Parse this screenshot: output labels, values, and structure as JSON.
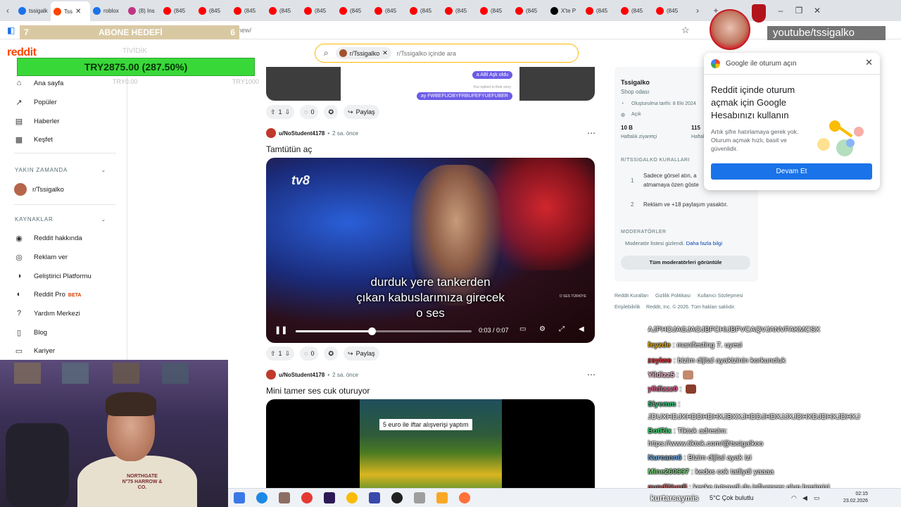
{
  "browser": {
    "tabs": [
      {
        "label": "tssigalko",
        "color": "#1a73e8"
      },
      {
        "label": "Tss",
        "color": "#ff4500",
        "active": true
      },
      {
        "label": "roblox",
        "color": "#1a73e8"
      },
      {
        "label": "(8) Ins",
        "color": "#c13584"
      },
      {
        "label": "(845",
        "color": "#ff0000"
      },
      {
        "label": "(845",
        "color": "#ff0000"
      },
      {
        "label": "(845",
        "color": "#ff0000"
      },
      {
        "label": "(845",
        "color": "#ff0000"
      },
      {
        "label": "(845",
        "color": "#ff0000"
      },
      {
        "label": "(845",
        "color": "#ff0000"
      },
      {
        "label": "(845",
        "color": "#ff0000"
      },
      {
        "label": "(845",
        "color": "#ff0000"
      },
      {
        "label": "(845",
        "color": "#ff0000"
      },
      {
        "label": "(845",
        "color": "#ff0000"
      },
      {
        "label": "(845",
        "color": "#ff0000"
      },
      {
        "label": "X'te P",
        "color": "#000000"
      },
      {
        "label": "(845",
        "color": "#ff0000"
      },
      {
        "label": "(845",
        "color": "#ff0000"
      },
      {
        "label": "(845",
        "color": "#ff0000"
      }
    ],
    "url_fragment": "new/"
  },
  "overlay": {
    "goal_left": "7",
    "goal_label": "ABONE HEDEFİ",
    "goal_right": "6",
    "donation": "TRY2875.00 (287.50%)",
    "scale_left": "TRY0.00",
    "scale_right": "TRY1000",
    "watermark": "TİVİDİK",
    "yt_handle": "youtube/tssigalko"
  },
  "reddit": {
    "logo": "reddit",
    "search_chip": "r/Tssigalko",
    "search_placeholder": "r/Tssigalko içinde ara"
  },
  "sidebar": {
    "items": [
      {
        "label": "Ana sayfa",
        "icon": "home-icon",
        "glyph": "⌂"
      },
      {
        "label": "Popüler",
        "icon": "popular-icon",
        "glyph": "↗"
      },
      {
        "label": "Haberler",
        "icon": "news-icon",
        "glyph": "▤"
      },
      {
        "label": "Keşfet",
        "icon": "explore-icon",
        "glyph": "▦"
      }
    ],
    "recent_heading": "YAKIN ZAMANDA",
    "recent_item": "r/Tssigalko",
    "resources_heading": "KAYNAKLAR",
    "resources": [
      {
        "label": "Reddit hakkında",
        "icon": "reddit-about-icon",
        "glyph": "◉"
      },
      {
        "label": "Reklam ver",
        "icon": "advertise-icon",
        "glyph": "◎"
      },
      {
        "label": "Geliştirici Platformu",
        "icon": "developer-icon",
        "glyph": "◑"
      },
      {
        "label": "Reddit Pro",
        "icon": "reddit-pro-icon",
        "glyph": "◐",
        "badge": "BETA"
      },
      {
        "label": "Yardım Merkezi",
        "icon": "help-icon",
        "glyph": "?"
      },
      {
        "label": "Blog",
        "icon": "blog-icon",
        "glyph": "▯"
      },
      {
        "label": "Kariyer",
        "icon": "careers-icon",
        "glyph": "▭"
      }
    ]
  },
  "feed": {
    "top_post": {
      "bubble1": "a ABİ Aşk oldu",
      "note": "You replied to their story",
      "bubble2": "ay FWBEFUOBYFRBUFEFYUEFUBER",
      "votes": "1",
      "comments": "0",
      "share": "Paylaş"
    },
    "post1": {
      "user": "u/NoStudent4178",
      "time": "2 sa. önce",
      "title": "Tamtütün aç",
      "channel_logo": "tv8",
      "subtitle_line1": "durduk yere  tankerden",
      "subtitle_line2": "çıkan kabuslarımıza girecek",
      "subtitle_line3": "o ses",
      "watermark": "O SES TÜRKİYE",
      "time_display": "0:03 / 0:07",
      "progress": 0.43,
      "votes": "1",
      "comments": "0",
      "share": "Paylaş"
    },
    "post2": {
      "user": "u/NoStudent4178",
      "time": "2 sa. önce",
      "title": "Mini tamer ses cuk oturuyor",
      "caption": "5 euro ile iftar alışverişi yaptım"
    }
  },
  "rsb": {
    "name": "Tssigalko",
    "desc": "Shop odası",
    "created": "Oluşturulma tarihi: 8 Eki 2024",
    "visibility": "Açık",
    "visitors_value": "10 B",
    "visitors_label": "Haftalık ziyaretçi",
    "contrib_value": "115",
    "contrib_label": "Haftalık",
    "rules_heading": "R/TSSIGALKO KURALLARI",
    "rule1_num": "1",
    "rule1": "Sadece görsel atın, a",
    "rule1b": "atmamaya özen göste",
    "rule2_num": "2",
    "rule2": "Reklam ve +18 paylaşım yasaktır.",
    "mod_heading": "MODERATÖRLER",
    "mod_hidden": "Moderatör listesi gizlendi.",
    "mod_more": "Daha fazla bilgi",
    "mod_button": "Tüm moderatörleri görüntüle",
    "footer_links": [
      "Reddit Kuralları",
      "Gizlilik Politikası",
      "Kullanıcı Sözleşmesi"
    ],
    "footer2": "Erişilebilirlik",
    "copyright": "Reddit, Inc. © 2026. Tüm hakları saklıdır."
  },
  "google_popup": {
    "header": "Google ile oturum açın",
    "title": "Reddit içinde oturum açmak için Google Hesabınızı kullanın",
    "desc": "Artık şifre hatırlamaya gerek yok. Oturum açmak hızlı, basit ve güvenlidir.",
    "button": "Devam Et"
  },
  "webcam": {
    "shirt_text": "NORTHGATE N°75 HARROW & CO."
  },
  "chat": [
    {
      "name": "",
      "text": "AJPHOJAGJAOJBFCHIJBFVCAQVJANVFAKMCSX",
      "color": "#ffffff"
    },
    {
      "name": "feyzde",
      "text": ": manifesting 7. uyesi",
      "color": "#e0a800"
    },
    {
      "name": "zsyiwe",
      "text": ": bizim dijital ayakizinin korkuncluk",
      "color": "#d2343b"
    },
    {
      "name": "Yildizz5",
      "text": ":",
      "color": "#f5b7d0",
      "emote": "#c28a6e"
    },
    {
      "name": "yildizzz0",
      "text": ":",
      "color": "#e05a8a",
      "emote": "#8a3d2a"
    },
    {
      "name": "Siyemm",
      "text": ":",
      "color": "#36c27a"
    },
    {
      "name": "",
      "text": "JDUXHDJXHDDHDHXJBXXJHDDJHDXJJXJDHXDJDHXJDHXJ",
      "color": "#ffffff"
    },
    {
      "name": "BotRix",
      "text": ": Tiktok adresim:",
      "color": "#3bd16f"
    },
    {
      "name": "",
      "text": "https://www.tiktok.com/@tssigalkoo",
      "color": "#ffffff"
    },
    {
      "name": "Nurcann6",
      "text": ": Bizim dijital ayak izi",
      "color": "#6fa8dc"
    },
    {
      "name": "Mine260997",
      "text": ": kedos cok tatliydi yaaaa",
      "color": "#7bd67b"
    },
    {
      "name": "gundiNurdi",
      "text": ": keske tutsaydi da influencer olup hepimizi",
      "color": "#c06a6a"
    }
  ],
  "taskbar": {
    "user": "kurtarsaymis",
    "weather": "5°C  Çok bulutlu",
    "time": "02:15",
    "date": "23.02.2026"
  }
}
